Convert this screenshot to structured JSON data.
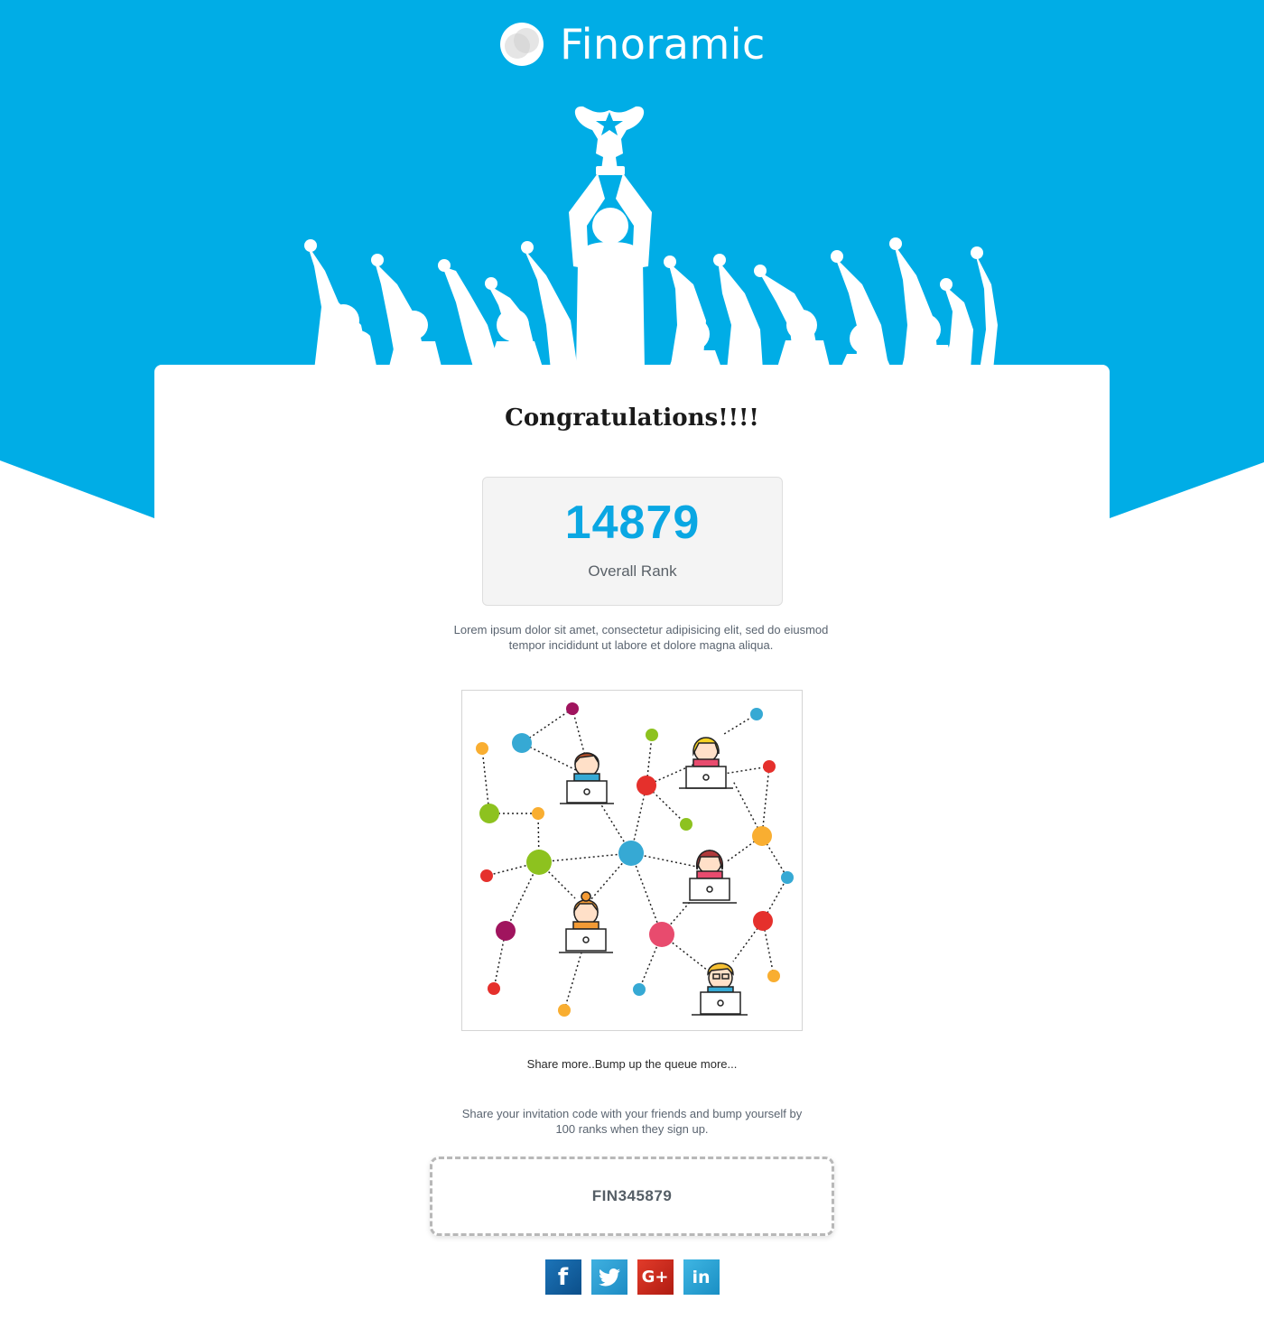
{
  "brand": {
    "name": "Finoramic",
    "logo_icon": "finoramic-logo-icon",
    "primary_color": "#00ade6"
  },
  "hero": {
    "illustration": "celebrating-crowd-trophy-icon"
  },
  "main": {
    "title": "Congratulations!!!!",
    "rank": {
      "value": "14879",
      "label": "Overall Rank"
    },
    "description": "Lorem ipsum dolor sit amet, consectetur adipisicing elit, sed do eiusmod tempor incididunt ut labore et dolore magna aliqua.",
    "illustration": "social-network-people-icon",
    "share_line": "Share more..Bump up the queue more...",
    "share_description": "Share your invitation code with your friends and bump yourself by 100 ranks when they sign up.",
    "invite_code": "FIN345879"
  },
  "social": [
    {
      "name": "facebook",
      "glyph": "f",
      "icon": "facebook-icon"
    },
    {
      "name": "twitter",
      "glyph": "",
      "icon": "twitter-icon"
    },
    {
      "name": "google-plus",
      "glyph": "G+",
      "icon": "google-plus-icon"
    },
    {
      "name": "linkedin",
      "glyph": "in",
      "icon": "linkedin-icon"
    }
  ]
}
